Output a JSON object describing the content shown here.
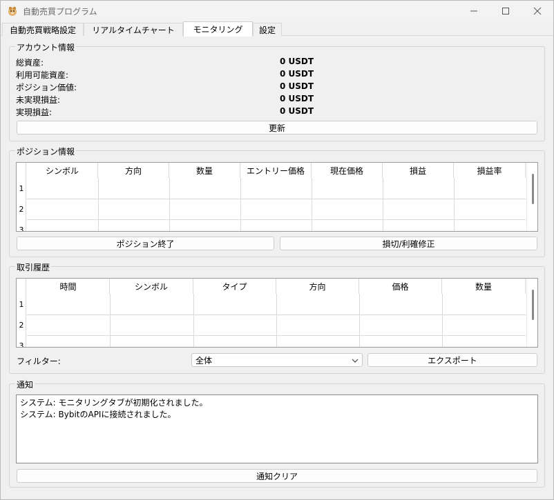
{
  "window": {
    "title": "自動売買プログラム"
  },
  "tabs": [
    {
      "label": "自動売買戦略設定"
    },
    {
      "label": "リアルタイムチャート"
    },
    {
      "label": "モニタリング"
    },
    {
      "label": "設定"
    }
  ],
  "account": {
    "title": "アカウント情報",
    "rows": [
      {
        "label": "総資産:",
        "value": "0 USDT"
      },
      {
        "label": "利用可能資産:",
        "value": "0 USDT"
      },
      {
        "label": "ポジション価値:",
        "value": "0 USDT"
      },
      {
        "label": "未実現損益:",
        "value": "0 USDT"
      },
      {
        "label": "実現損益:",
        "value": "0 USDT"
      }
    ],
    "refresh_label": "更新"
  },
  "positions": {
    "title": "ポジション情報",
    "columns": [
      "シンボル",
      "方向",
      "数量",
      "エントリー価格",
      "現在価格",
      "損益",
      "損益率"
    ],
    "row_numbers": [
      "1",
      "2",
      "3"
    ],
    "close_label": "ポジション終了",
    "modify_label": "損切/利確修正"
  },
  "history": {
    "title": "取引履歴",
    "columns": [
      "時間",
      "シンボル",
      "タイプ",
      "方向",
      "価格",
      "数量"
    ],
    "row_numbers": [
      "1",
      "2",
      "3"
    ],
    "filter_label": "フィルター:",
    "filter_value": "全体",
    "export_label": "エクスポート"
  },
  "notifications": {
    "title": "通知",
    "lines": [
      "システム: モニタリングタブが初期化されました。",
      "システム: BybitのAPIに接続されました。"
    ],
    "clear_label": "通知クリア"
  }
}
